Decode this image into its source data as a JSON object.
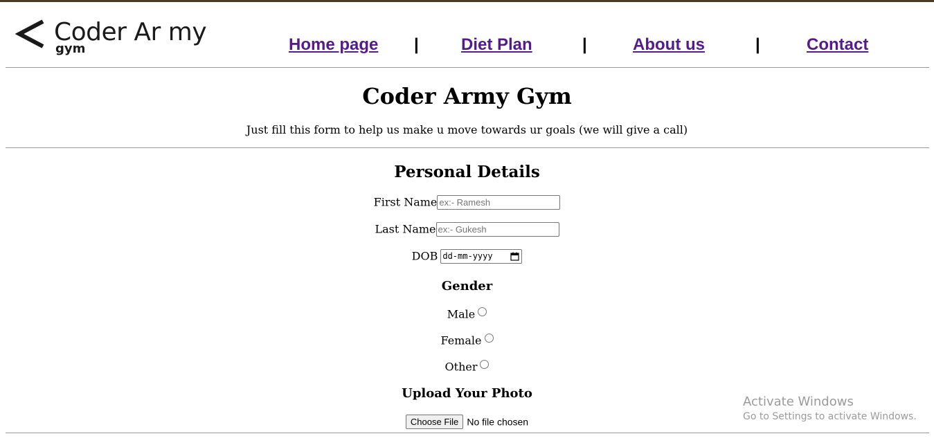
{
  "logo": {
    "title": "Coder Ar my",
    "subtitle": "gym"
  },
  "nav": {
    "items": [
      {
        "label": "Home page"
      },
      {
        "label": "Diet Plan"
      },
      {
        "label": "About us"
      },
      {
        "label": "Contact"
      }
    ],
    "separator": "|"
  },
  "header": {
    "title": "Coder Army Gym",
    "tagline": "Just fill this form to help us make u move towards ur goals (we will give a call)"
  },
  "form": {
    "section_title": "Personal Details",
    "first_name": {
      "label": "First Name",
      "placeholder": "ex:- Ramesh"
    },
    "last_name": {
      "label": "Last Name",
      "placeholder": "ex:- Gukesh"
    },
    "dob": {
      "label": "DOB",
      "placeholder": "dd-mm-yyyy"
    },
    "gender": {
      "title": "Gender",
      "options": [
        {
          "label": "Male"
        },
        {
          "label": "Female"
        },
        {
          "label": "Other"
        }
      ]
    },
    "photo": {
      "title": "Upload Your Photo",
      "button_label": "Choose File",
      "status": "No file chosen"
    }
  },
  "watermark": {
    "line1": "Activate Windows",
    "line2": "Go to Settings to activate Windows."
  }
}
